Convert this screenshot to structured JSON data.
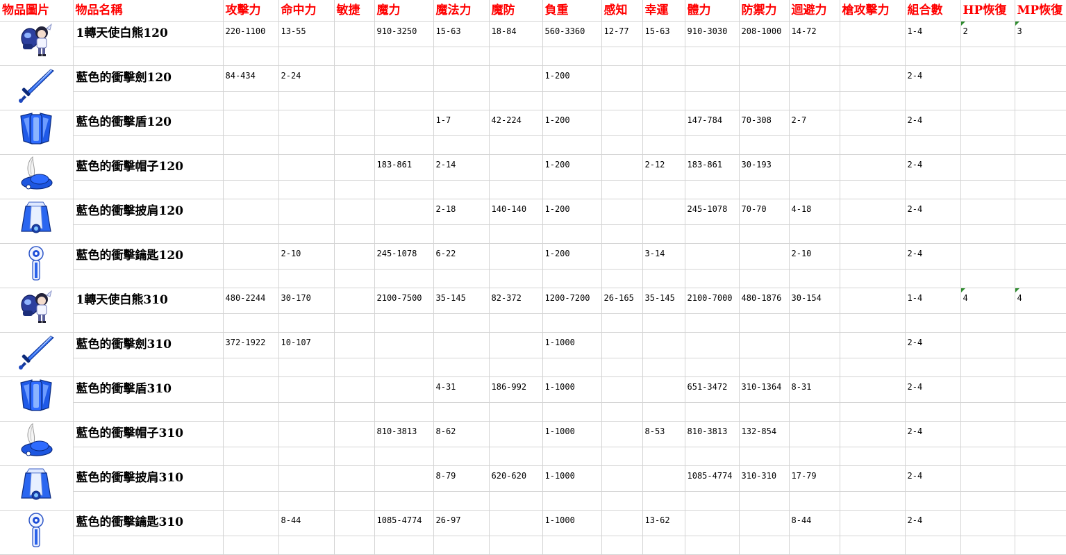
{
  "headers": [
    "物品圖片",
    "物品名稱",
    "攻擊力",
    "命中力",
    "敏捷",
    "魔力",
    "魔法力",
    "魔防",
    "負重",
    "感知",
    "幸運",
    "體力",
    "防禦力",
    "迴避力",
    "槍攻擊力",
    "組合數",
    "HP恢復",
    "MP恢復"
  ],
  "items": [
    {
      "icon": "angel-bear-icon",
      "name": "1轉天使白熊120",
      "vals": [
        "220-1100",
        "13-55",
        "",
        "910-3250",
        "15-63",
        "18-84",
        "560-3360",
        "12-77",
        "15-63",
        "910-3030",
        "208-1000",
        "14-72",
        "",
        "1-4",
        "2",
        "3"
      ],
      "notes": [
        14,
        15
      ]
    },
    {
      "icon": "sword-icon",
      "name": "藍色的衝擊劍120",
      "vals": [
        "84-434",
        "2-24",
        "",
        "",
        "",
        "",
        "1-200",
        "",
        "",
        "",
        "",
        "",
        "",
        "2-4",
        "",
        ""
      ],
      "notes": []
    },
    {
      "icon": "shield-icon",
      "name": "藍色的衝擊盾120",
      "vals": [
        "",
        "",
        "",
        "",
        "1-7",
        "42-224",
        "1-200",
        "",
        "",
        "147-784",
        "70-308",
        "2-7",
        "",
        "2-4",
        "",
        ""
      ],
      "notes": []
    },
    {
      "icon": "feather-hat-icon",
      "name": "藍色的衝擊帽子120",
      "vals": [
        "",
        "",
        "",
        "183-861",
        "2-14",
        "",
        "1-200",
        "",
        "2-12",
        "183-861",
        "30-193",
        "",
        "",
        "2-4",
        "",
        ""
      ],
      "notes": []
    },
    {
      "icon": "cape-icon",
      "name": "藍色的衝擊披肩120",
      "vals": [
        "",
        "",
        "",
        "",
        "2-18",
        "140-140",
        "1-200",
        "",
        "",
        "245-1078",
        "70-70",
        "4-18",
        "",
        "2-4",
        "",
        ""
      ],
      "notes": []
    },
    {
      "icon": "key-icon",
      "name": "藍色的衝擊鑰匙120",
      "vals": [
        "",
        "2-10",
        "",
        "245-1078",
        "6-22",
        "",
        "1-200",
        "",
        "3-14",
        "",
        "",
        "2-10",
        "",
        "2-4",
        "",
        ""
      ],
      "notes": []
    },
    {
      "icon": "angel-bear-icon",
      "name": "1轉天使白熊310",
      "vals": [
        "480-2244",
        "30-170",
        "",
        "2100-7500",
        "35-145",
        "82-372",
        "1200-7200",
        "26-165",
        "35-145",
        "2100-7000",
        "480-1876",
        "30-154",
        "",
        "1-4",
        "4",
        "4"
      ],
      "notes": [
        14,
        15
      ]
    },
    {
      "icon": "sword-icon",
      "name": "藍色的衝擊劍310",
      "vals": [
        "372-1922",
        "10-107",
        "",
        "",
        "",
        "",
        "1-1000",
        "",
        "",
        "",
        "",
        "",
        "",
        "2-4",
        "",
        ""
      ],
      "notes": []
    },
    {
      "icon": "shield-icon",
      "name": "藍色的衝擊盾310",
      "vals": [
        "",
        "",
        "",
        "",
        "4-31",
        "186-992",
        "1-1000",
        "",
        "",
        "651-3472",
        "310-1364",
        "8-31",
        "",
        "2-4",
        "",
        ""
      ],
      "notes": []
    },
    {
      "icon": "feather-hat-icon",
      "name": "藍色的衝擊帽子310",
      "vals": [
        "",
        "",
        "",
        "810-3813",
        "8-62",
        "",
        "1-1000",
        "",
        "8-53",
        "810-3813",
        "132-854",
        "",
        "",
        "2-4",
        "",
        ""
      ],
      "notes": []
    },
    {
      "icon": "cape-icon",
      "name": "藍色的衝擊披肩310",
      "vals": [
        "",
        "",
        "",
        "",
        "8-79",
        "620-620",
        "1-1000",
        "",
        "",
        "1085-4774",
        "310-310",
        "17-79",
        "",
        "2-4",
        "",
        ""
      ],
      "notes": []
    },
    {
      "icon": "key-icon",
      "name": "藍色的衝擊鑰匙310",
      "vals": [
        "",
        "8-44",
        "",
        "1085-4774",
        "26-97",
        "",
        "1-1000",
        "",
        "13-62",
        "",
        "",
        "8-44",
        "",
        "2-4",
        "",
        ""
      ]
    }
  ],
  "colors": {
    "header_text": "#ff0000",
    "grid": "#d4d4d4",
    "note_marker": "#2e8b2e",
    "item_blue": "#1a4fd6"
  }
}
